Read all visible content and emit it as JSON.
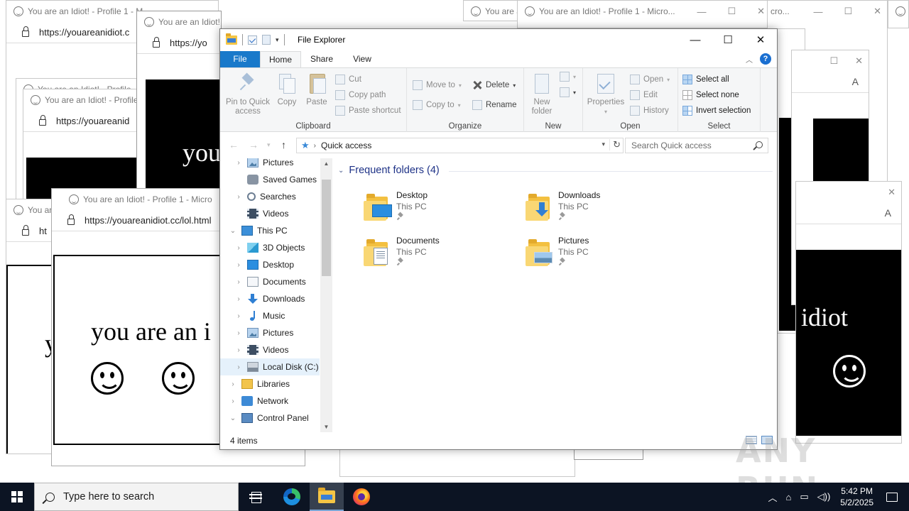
{
  "bg_windows": {
    "title_full": "You are an Idiot! - Profile 1 - Micro...",
    "title_short": "You are an Idiot! - Profile 1 - Micro",
    "title_a": "You are an Idiot! - Profile 1 - M",
    "title_b": "You are an Idiot! - Profile",
    "title_c": "You are ai",
    "title_d": "You are an Idiot! - Profile 1 - Micro...",
    "title_e": "cro...",
    "title_f": "You ar",
    "title_g": "You are an Idiot! - Profile 1 - Micro...",
    "url_full": "https://youareanidiot.cc/lol.html",
    "url_a": "https://youareanidiot.c",
    "url_b": "https://youareanid",
    "url_c": "https://yo",
    "url_d": "ht",
    "big_text": "you are an i",
    "frag_you": "you",
    "frag_idiot": "iot",
    "frag_idiot2": "n idiot",
    "frag_y": "y"
  },
  "explorer": {
    "title": "File Explorer",
    "tabs": [
      "File",
      "Home",
      "Share",
      "View"
    ],
    "ribbon": {
      "clipboard": {
        "label": "Clipboard",
        "pin": "Pin to Quick access",
        "copy": "Copy",
        "paste": "Paste",
        "cut": "Cut",
        "copy_path": "Copy path",
        "paste_shortcut": "Paste shortcut"
      },
      "organize": {
        "label": "Organize",
        "move_to": "Move to",
        "copy_to": "Copy to",
        "delete": "Delete",
        "rename": "Rename"
      },
      "new": {
        "label": "New",
        "new_folder": "New folder"
      },
      "open": {
        "label": "Open",
        "properties": "Properties",
        "open": "Open",
        "edit": "Edit",
        "history": "History"
      },
      "select": {
        "label": "Select",
        "select_all": "Select all",
        "select_none": "Select none",
        "invert": "Invert selection"
      }
    },
    "address": {
      "path": "Quick access",
      "search_placeholder": "Search Quick access"
    },
    "tree": [
      {
        "label": "Pictures",
        "icon": "pictures-icon"
      },
      {
        "label": "Saved Games",
        "icon": "saved-games-icon"
      },
      {
        "label": "Searches",
        "icon": "searches-icon"
      },
      {
        "label": "Videos",
        "icon": "videos-icon"
      },
      {
        "label": "This PC",
        "icon": "this-pc-icon"
      },
      {
        "label": "3D Objects",
        "icon": "3d-objects-icon"
      },
      {
        "label": "Desktop",
        "icon": "desktop-icon"
      },
      {
        "label": "Documents",
        "icon": "documents-icon"
      },
      {
        "label": "Downloads",
        "icon": "downloads-icon"
      },
      {
        "label": "Music",
        "icon": "music-icon"
      },
      {
        "label": "Pictures",
        "icon": "pictures-icon"
      },
      {
        "label": "Videos",
        "icon": "videos-icon"
      },
      {
        "label": "Local Disk (C:)",
        "icon": "local-disk-icon"
      },
      {
        "label": "Libraries",
        "icon": "libraries-icon"
      },
      {
        "label": "Network",
        "icon": "network-icon"
      },
      {
        "label": "Control Panel",
        "icon": "control-panel-icon"
      }
    ],
    "group_header": "Frequent folders (4)",
    "folders": [
      {
        "name": "Desktop",
        "location": "This PC"
      },
      {
        "name": "Downloads",
        "location": "This PC"
      },
      {
        "name": "Documents",
        "location": "This PC"
      },
      {
        "name": "Pictures",
        "location": "This PC"
      }
    ],
    "status": "4 items"
  },
  "taskbar": {
    "search_placeholder": "Type here to search",
    "time": "5:42 PM",
    "date": "5/2/2025"
  },
  "watermark": "ANY RUN",
  "colors": {
    "accent": "#1979ca",
    "taskbar": "#0c1423",
    "group_header": "#1e3287"
  }
}
